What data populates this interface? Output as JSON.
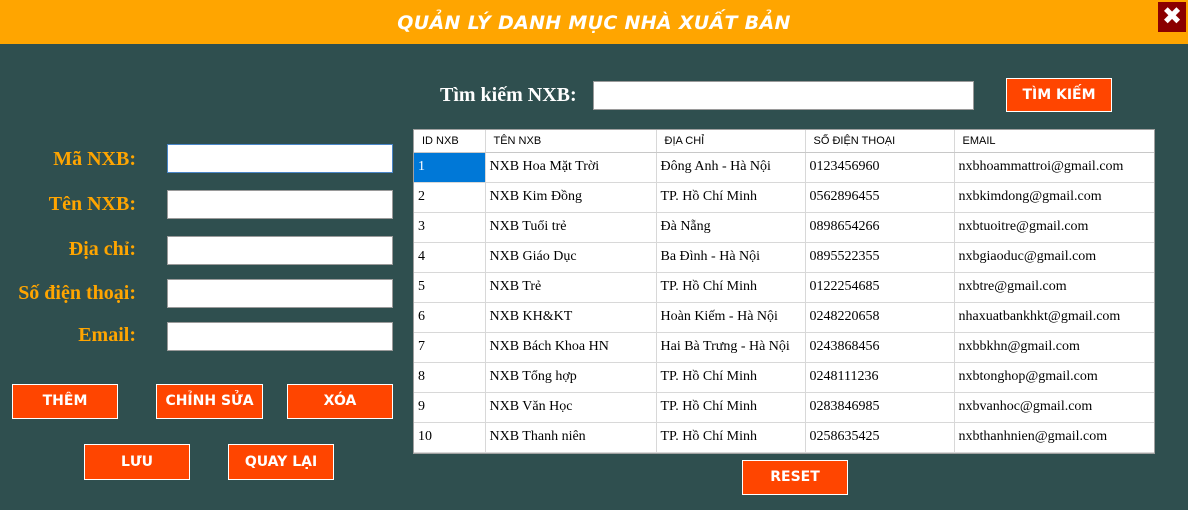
{
  "window": {
    "title": "QUẢN LÝ DANH MỤC NHÀ XUẤT BẢN",
    "close_glyph": "✖",
    "titlebar_color": "#ffa500",
    "background_color": "#2f4f4f"
  },
  "search": {
    "label": "Tìm kiếm NXB:",
    "value": "",
    "button_label": "TÌM KIẾM"
  },
  "form": {
    "fields": [
      {
        "label": "Mã NXB:",
        "value": ""
      },
      {
        "label": "Tên NXB:",
        "value": ""
      },
      {
        "label": "Địa chỉ:",
        "value": ""
      },
      {
        "label": "Số điện thoại:",
        "value": ""
      },
      {
        "label": "Email:",
        "value": ""
      }
    ]
  },
  "buttons": {
    "add": "THÊM",
    "edit": "CHỈNH SỬA",
    "delete": "XÓA",
    "save": "LƯU",
    "back": "QUAY LẠI",
    "reset": "RESET"
  },
  "colors": {
    "accent": "#ff4500",
    "label": "#ffa500",
    "selection": "#0078d7"
  },
  "table": {
    "columns": [
      "ID NXB",
      "TÊN NXB",
      "ĐỊA CHỈ",
      "SỐ ĐIỆN THOẠI",
      "EMAIL"
    ],
    "rows": [
      [
        "1",
        "NXB Hoa Mặt Trời",
        "Đông Anh - Hà Nội",
        "0123456960",
        "nxbhoammattroi@gmail.com"
      ],
      [
        "2",
        "NXB Kim Đồng",
        "TP. Hồ Chí Minh",
        "0562896455",
        "nxbkimdong@gmail.com"
      ],
      [
        "3",
        "NXB Tuổi trẻ",
        "Đà Nẵng",
        "0898654266",
        "nxbtuoitre@gmail.com"
      ],
      [
        "4",
        "NXB Giáo Dục",
        "Ba Đình - Hà Nội",
        "0895522355",
        "nxbgiaoduc@gmail.com"
      ],
      [
        "5",
        "NXB Trẻ",
        "TP. Hồ Chí Minh",
        "0122254685",
        "nxbtre@gmail.com"
      ],
      [
        "6",
        "NXB KH&KT",
        "Hoàn Kiếm - Hà Nội",
        "0248220658",
        "nhaxuatbankhkt@gmail.com"
      ],
      [
        "7",
        "NXB Bách Khoa HN",
        "Hai Bà Trưng - Hà Nội",
        "0243868456",
        "nxbbkhn@gmail.com"
      ],
      [
        "8",
        "NXB Tổng hợp",
        "TP. Hồ Chí Minh",
        "0248111236",
        "nxbtonghop@gmail.com"
      ],
      [
        "9",
        "NXB Văn Học",
        "TP. Hồ Chí Minh",
        "0283846985",
        "nxbvanhoc@gmail.com"
      ],
      [
        "10",
        "NXB Thanh niên",
        "TP. Hồ Chí Minh",
        "0258635425",
        "nxbthanhnien@gmail.com"
      ]
    ]
  }
}
